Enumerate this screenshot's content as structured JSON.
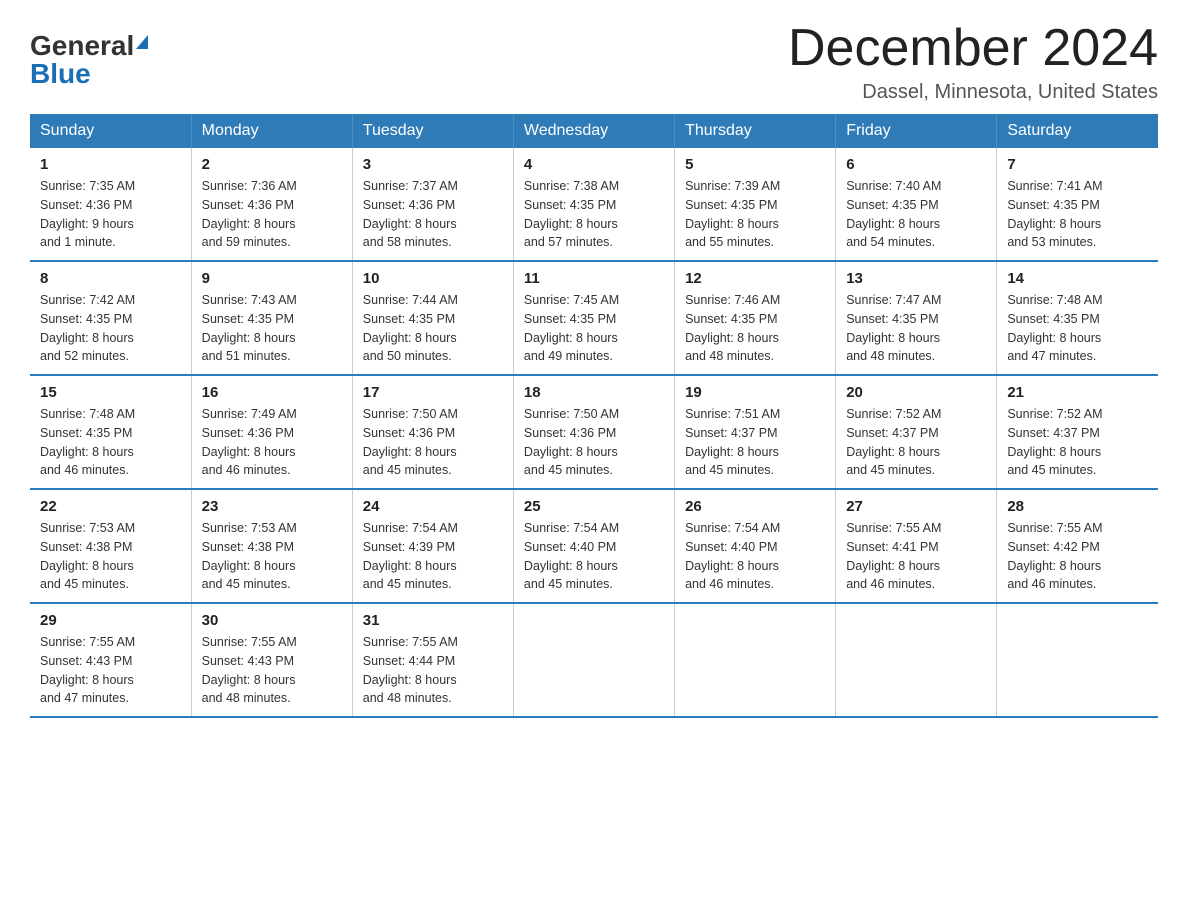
{
  "header": {
    "logo_general": "General",
    "logo_blue": "Blue",
    "month_title": "December 2024",
    "location": "Dassel, Minnesota, United States"
  },
  "days_of_week": [
    "Sunday",
    "Monday",
    "Tuesday",
    "Wednesday",
    "Thursday",
    "Friday",
    "Saturday"
  ],
  "weeks": [
    [
      {
        "day": "1",
        "sunrise": "Sunrise: 7:35 AM",
        "sunset": "Sunset: 4:36 PM",
        "daylight": "Daylight: 9 hours",
        "daylight2": "and 1 minute."
      },
      {
        "day": "2",
        "sunrise": "Sunrise: 7:36 AM",
        "sunset": "Sunset: 4:36 PM",
        "daylight": "Daylight: 8 hours",
        "daylight2": "and 59 minutes."
      },
      {
        "day": "3",
        "sunrise": "Sunrise: 7:37 AM",
        "sunset": "Sunset: 4:36 PM",
        "daylight": "Daylight: 8 hours",
        "daylight2": "and 58 minutes."
      },
      {
        "day": "4",
        "sunrise": "Sunrise: 7:38 AM",
        "sunset": "Sunset: 4:35 PM",
        "daylight": "Daylight: 8 hours",
        "daylight2": "and 57 minutes."
      },
      {
        "day": "5",
        "sunrise": "Sunrise: 7:39 AM",
        "sunset": "Sunset: 4:35 PM",
        "daylight": "Daylight: 8 hours",
        "daylight2": "and 55 minutes."
      },
      {
        "day": "6",
        "sunrise": "Sunrise: 7:40 AM",
        "sunset": "Sunset: 4:35 PM",
        "daylight": "Daylight: 8 hours",
        "daylight2": "and 54 minutes."
      },
      {
        "day": "7",
        "sunrise": "Sunrise: 7:41 AM",
        "sunset": "Sunset: 4:35 PM",
        "daylight": "Daylight: 8 hours",
        "daylight2": "and 53 minutes."
      }
    ],
    [
      {
        "day": "8",
        "sunrise": "Sunrise: 7:42 AM",
        "sunset": "Sunset: 4:35 PM",
        "daylight": "Daylight: 8 hours",
        "daylight2": "and 52 minutes."
      },
      {
        "day": "9",
        "sunrise": "Sunrise: 7:43 AM",
        "sunset": "Sunset: 4:35 PM",
        "daylight": "Daylight: 8 hours",
        "daylight2": "and 51 minutes."
      },
      {
        "day": "10",
        "sunrise": "Sunrise: 7:44 AM",
        "sunset": "Sunset: 4:35 PM",
        "daylight": "Daylight: 8 hours",
        "daylight2": "and 50 minutes."
      },
      {
        "day": "11",
        "sunrise": "Sunrise: 7:45 AM",
        "sunset": "Sunset: 4:35 PM",
        "daylight": "Daylight: 8 hours",
        "daylight2": "and 49 minutes."
      },
      {
        "day": "12",
        "sunrise": "Sunrise: 7:46 AM",
        "sunset": "Sunset: 4:35 PM",
        "daylight": "Daylight: 8 hours",
        "daylight2": "and 48 minutes."
      },
      {
        "day": "13",
        "sunrise": "Sunrise: 7:47 AM",
        "sunset": "Sunset: 4:35 PM",
        "daylight": "Daylight: 8 hours",
        "daylight2": "and 48 minutes."
      },
      {
        "day": "14",
        "sunrise": "Sunrise: 7:48 AM",
        "sunset": "Sunset: 4:35 PM",
        "daylight": "Daylight: 8 hours",
        "daylight2": "and 47 minutes."
      }
    ],
    [
      {
        "day": "15",
        "sunrise": "Sunrise: 7:48 AM",
        "sunset": "Sunset: 4:35 PM",
        "daylight": "Daylight: 8 hours",
        "daylight2": "and 46 minutes."
      },
      {
        "day": "16",
        "sunrise": "Sunrise: 7:49 AM",
        "sunset": "Sunset: 4:36 PM",
        "daylight": "Daylight: 8 hours",
        "daylight2": "and 46 minutes."
      },
      {
        "day": "17",
        "sunrise": "Sunrise: 7:50 AM",
        "sunset": "Sunset: 4:36 PM",
        "daylight": "Daylight: 8 hours",
        "daylight2": "and 45 minutes."
      },
      {
        "day": "18",
        "sunrise": "Sunrise: 7:50 AM",
        "sunset": "Sunset: 4:36 PM",
        "daylight": "Daylight: 8 hours",
        "daylight2": "and 45 minutes."
      },
      {
        "day": "19",
        "sunrise": "Sunrise: 7:51 AM",
        "sunset": "Sunset: 4:37 PM",
        "daylight": "Daylight: 8 hours",
        "daylight2": "and 45 minutes."
      },
      {
        "day": "20",
        "sunrise": "Sunrise: 7:52 AM",
        "sunset": "Sunset: 4:37 PM",
        "daylight": "Daylight: 8 hours",
        "daylight2": "and 45 minutes."
      },
      {
        "day": "21",
        "sunrise": "Sunrise: 7:52 AM",
        "sunset": "Sunset: 4:37 PM",
        "daylight": "Daylight: 8 hours",
        "daylight2": "and 45 minutes."
      }
    ],
    [
      {
        "day": "22",
        "sunrise": "Sunrise: 7:53 AM",
        "sunset": "Sunset: 4:38 PM",
        "daylight": "Daylight: 8 hours",
        "daylight2": "and 45 minutes."
      },
      {
        "day": "23",
        "sunrise": "Sunrise: 7:53 AM",
        "sunset": "Sunset: 4:38 PM",
        "daylight": "Daylight: 8 hours",
        "daylight2": "and 45 minutes."
      },
      {
        "day": "24",
        "sunrise": "Sunrise: 7:54 AM",
        "sunset": "Sunset: 4:39 PM",
        "daylight": "Daylight: 8 hours",
        "daylight2": "and 45 minutes."
      },
      {
        "day": "25",
        "sunrise": "Sunrise: 7:54 AM",
        "sunset": "Sunset: 4:40 PM",
        "daylight": "Daylight: 8 hours",
        "daylight2": "and 45 minutes."
      },
      {
        "day": "26",
        "sunrise": "Sunrise: 7:54 AM",
        "sunset": "Sunset: 4:40 PM",
        "daylight": "Daylight: 8 hours",
        "daylight2": "and 46 minutes."
      },
      {
        "day": "27",
        "sunrise": "Sunrise: 7:55 AM",
        "sunset": "Sunset: 4:41 PM",
        "daylight": "Daylight: 8 hours",
        "daylight2": "and 46 minutes."
      },
      {
        "day": "28",
        "sunrise": "Sunrise: 7:55 AM",
        "sunset": "Sunset: 4:42 PM",
        "daylight": "Daylight: 8 hours",
        "daylight2": "and 46 minutes."
      }
    ],
    [
      {
        "day": "29",
        "sunrise": "Sunrise: 7:55 AM",
        "sunset": "Sunset: 4:43 PM",
        "daylight": "Daylight: 8 hours",
        "daylight2": "and 47 minutes."
      },
      {
        "day": "30",
        "sunrise": "Sunrise: 7:55 AM",
        "sunset": "Sunset: 4:43 PM",
        "daylight": "Daylight: 8 hours",
        "daylight2": "and 48 minutes."
      },
      {
        "day": "31",
        "sunrise": "Sunrise: 7:55 AM",
        "sunset": "Sunset: 4:44 PM",
        "daylight": "Daylight: 8 hours",
        "daylight2": "and 48 minutes."
      },
      null,
      null,
      null,
      null
    ]
  ]
}
